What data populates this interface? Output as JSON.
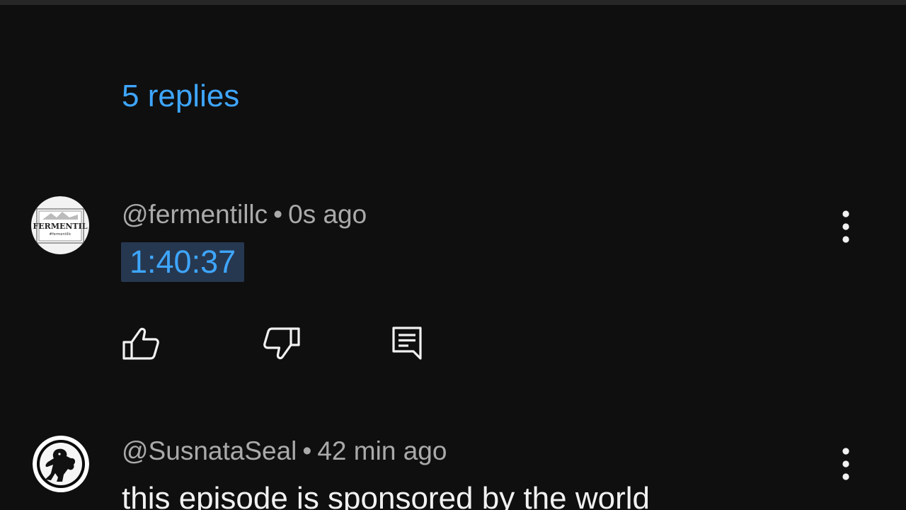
{
  "replies": {
    "label": "5 replies"
  },
  "comments": [
    {
      "handle": "@fermentillc",
      "separator": "•",
      "time": "0s ago",
      "timestamp": "1:40:37",
      "avatar": {
        "brand": "FERMENTIL",
        "tagline": "#fermentillc"
      },
      "icons": {
        "like": "thumb-up-icon",
        "dislike": "thumb-down-icon",
        "reply": "comment-reply-icon",
        "more": "more-vert-icon"
      }
    },
    {
      "handle": "@SusnataSeal",
      "separator": "•",
      "time": "42 min ago",
      "text": "this episode is sponsored by the world",
      "icons": {
        "more": "more-vert-icon"
      }
    }
  ],
  "colors": {
    "background": "#0f0f0f",
    "link_blue": "#3ea6ff",
    "chip_bg": "#263850",
    "meta_gray": "#aaaaaa",
    "text": "#f1f1f1"
  }
}
